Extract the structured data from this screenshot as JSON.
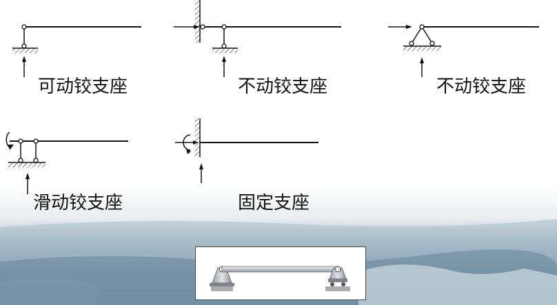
{
  "labels": {
    "movable_hinge": "可动铰支座",
    "fixed_hinge_1": "不动铰支座",
    "fixed_hinge_2": "不动铰支座",
    "sliding_hinge": "滑动铰支座",
    "fixed_support": "固定支座"
  },
  "colors": {
    "line": "#111111",
    "sky_top": "#dfe7ec",
    "sea": "#6f8ea3",
    "beam_fill": "#c9cdd2",
    "support_fill": "#bfc3c8"
  }
}
